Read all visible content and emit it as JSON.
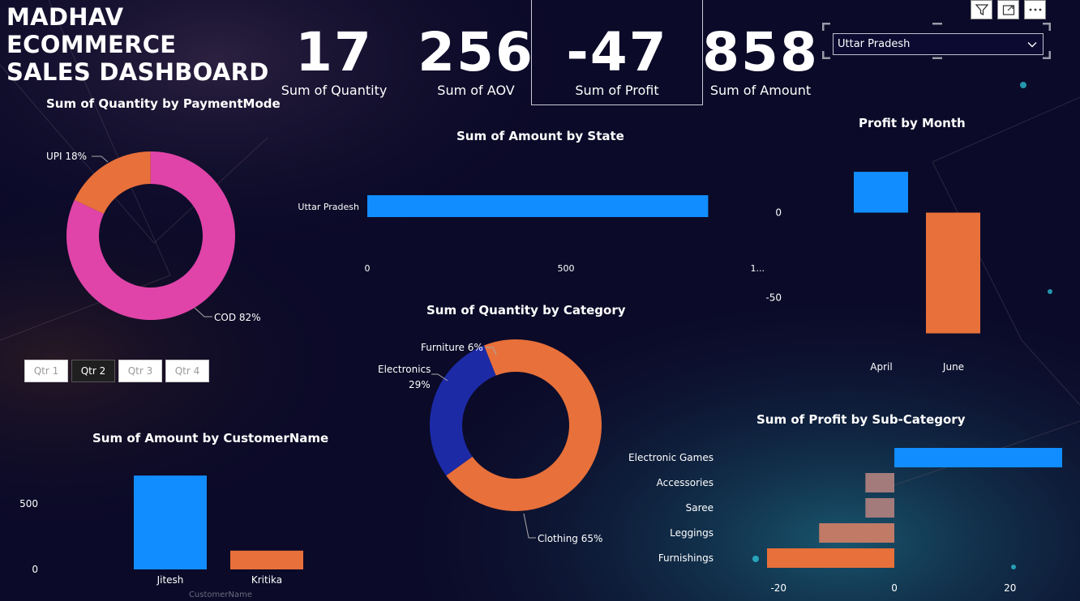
{
  "header": {
    "title_line1": "MADHAV ECOMMERCE",
    "title_line2": "SALES DASHBOARD"
  },
  "kpis": [
    {
      "value": "17",
      "label": "Sum of Quantity"
    },
    {
      "value": "256",
      "label": "Sum of AOV"
    },
    {
      "value": "-47",
      "label": "Sum of Profit"
    },
    {
      "value": "858",
      "label": "Sum of Amount"
    }
  ],
  "slicer": {
    "state_value": "Uttar Pradesh"
  },
  "toolbar": {
    "filter_icon": "filter-icon",
    "focus_icon": "focus-mode-icon",
    "more_icon": "more-options-icon"
  },
  "quarter_buttons": [
    {
      "label": "Qtr 1",
      "selected": false
    },
    {
      "label": "Qtr 2",
      "selected": true
    },
    {
      "label": "Qtr 3",
      "selected": false
    },
    {
      "label": "Qtr 4",
      "selected": false
    }
  ],
  "chart_data": [
    {
      "id": "payment",
      "type": "pie",
      "title": "Sum of Quantity by PaymentMode",
      "slices": [
        {
          "label": "UPI 18%",
          "value": 18,
          "color": "#e8703a"
        },
        {
          "label": "COD 82%",
          "value": 82,
          "color": "#e044a8"
        }
      ]
    },
    {
      "id": "state",
      "type": "bar",
      "title": "Sum of Amount by State",
      "categories": [
        "Uttar Pradesh"
      ],
      "values": [
        858
      ],
      "xlim": [
        0,
        1000
      ],
      "xticks": [
        "0",
        "500",
        "1..."
      ],
      "color": "#118dff"
    },
    {
      "id": "month",
      "type": "bar",
      "title": "Profit by Month",
      "categories": [
        "April",
        "June"
      ],
      "values": [
        24,
        -71
      ],
      "ylim": [
        -75,
        25
      ],
      "yticks": [
        {
          "v": 0,
          "t": "0"
        },
        {
          "v": -50,
          "t": "-50"
        }
      ],
      "colors": [
        "#118dff",
        "#e8703a"
      ]
    },
    {
      "id": "category",
      "type": "pie",
      "title": "Sum of Quantity by Category",
      "slices": [
        {
          "label": "Clothing 65%",
          "value": 65,
          "color": "#e8703a"
        },
        {
          "label": "Electronics 29%",
          "value": 29,
          "color": "#1c2aa6"
        },
        {
          "label": "Furniture 6%",
          "value": 6,
          "color": "#e8703a"
        }
      ]
    },
    {
      "id": "customer",
      "type": "bar",
      "title": "Sum of Amount by CustomerName",
      "xlabel": "CustomerName",
      "categories": [
        "Jitesh",
        "Kritika"
      ],
      "values": [
        715,
        143
      ],
      "ylim": [
        0,
        900
      ],
      "yticks": [
        {
          "v": 0,
          "t": "0"
        },
        {
          "v": 500,
          "t": "500"
        }
      ],
      "colors": [
        "#118dff",
        "#e8703a"
      ]
    },
    {
      "id": "subcat",
      "type": "bar",
      "title": "Sum of Profit by Sub-Category",
      "categories": [
        "Electronic Games",
        "Accessories",
        "Saree",
        "Leggings",
        "Furnishings"
      ],
      "values": [
        29,
        -5,
        -5,
        -13,
        -22
      ],
      "xlim": [
        -22,
        29
      ],
      "xticks": [
        {
          "v": -20,
          "t": "-20"
        },
        {
          "v": 0,
          "t": "0"
        },
        {
          "v": 20,
          "t": "20"
        }
      ],
      "colors": [
        "#118dff",
        "#a37b7b",
        "#a37b7b",
        "#c07a66",
        "#e8703a"
      ]
    }
  ]
}
